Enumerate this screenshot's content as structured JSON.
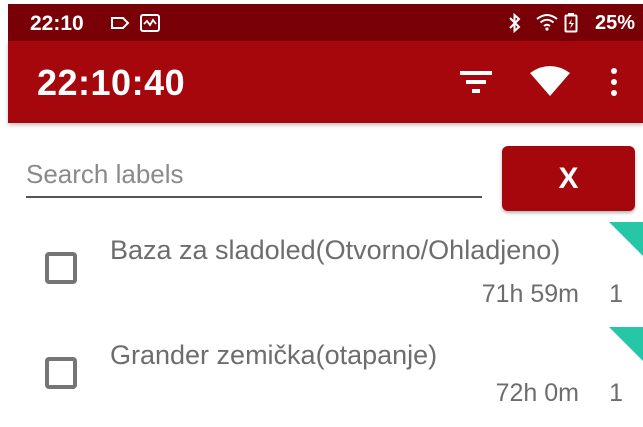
{
  "status_bar": {
    "time": "22:10",
    "battery": "25%",
    "icons": [
      "notification-tag-icon",
      "notification-image-icon",
      "bluetooth-icon",
      "wifi-icon",
      "battery-icon"
    ]
  },
  "app_bar": {
    "title": "22:10:40",
    "icons": [
      "filter-icon",
      "wifi-signal-icon",
      "more-vert-icon"
    ]
  },
  "search": {
    "placeholder": "Search labels",
    "value": "",
    "clear_label": "X"
  },
  "items": [
    {
      "label": "Baza za sladoled(Otvorno/Ohladjeno)",
      "duration": "71h 59m",
      "count": "1",
      "checked": false
    },
    {
      "label": "Grander zemička(otapanje)",
      "duration": "72h 0m",
      "count": "1",
      "checked": false
    }
  ],
  "colors": {
    "status_bar": "#7a0007",
    "app_bar": "#a6070d",
    "accent_tag": "#26c7a6",
    "text_secondary": "#6d6d6d"
  }
}
